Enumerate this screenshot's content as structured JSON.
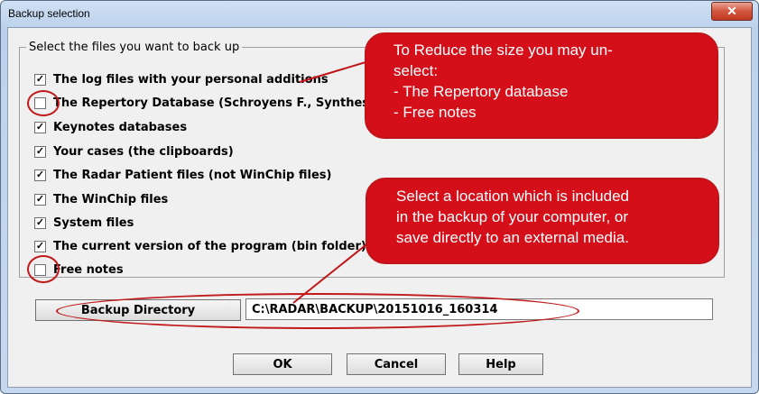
{
  "window": {
    "title": "Backup selection",
    "close_glyph": "✕"
  },
  "group": {
    "legend": "Select the files you want to back up"
  },
  "options": [
    {
      "label": "The log files with your personal additions",
      "checked": true
    },
    {
      "label": "The Repertory Database (Schroyens F., Synthes",
      "checked": false
    },
    {
      "label": "Keynotes databases",
      "checked": true
    },
    {
      "label": "Your cases (the clipboards)",
      "checked": true
    },
    {
      "label": "The Radar Patient files (not WinChip files)",
      "checked": true
    },
    {
      "label": "The WinChip files",
      "checked": true
    },
    {
      "label": "System files",
      "checked": true
    },
    {
      "label": "The current version of the program (bin folder)",
      "checked": true
    },
    {
      "label": "Free notes",
      "checked": false
    }
  ],
  "backup": {
    "button_label": "Backup Directory",
    "path": "C:\\RADAR\\BACKUP\\20151016_160314"
  },
  "footer": {
    "ok_label": "OK",
    "cancel_label": "Cancel",
    "help_label": "Help"
  },
  "callouts": {
    "top": [
      "To Reduce the size you may un-",
      "select:",
      "- The Repertory database",
      "- Free notes"
    ],
    "bottom": [
      "Select a location which is included",
      "in the backup of your computer, or",
      "save directly to an external media."
    ]
  },
  "colors": {
    "callout": "#d40f1a",
    "highlight_ring": "#c01a1a"
  }
}
